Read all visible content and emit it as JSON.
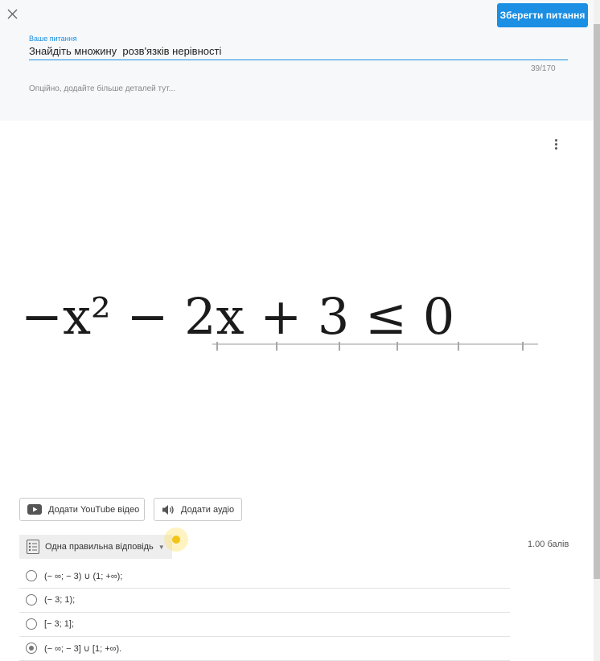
{
  "editor": {
    "save_button_label": "Зберегти питання",
    "question_field_label": "Ваше питання",
    "question_text": "Знайдіть множину  розв'язків нерівності",
    "char_counter": "39/170",
    "details_placeholder": "Опційно, додайте більше деталей тут..."
  },
  "media": {
    "math_image_text": "−x² − 2x + 3 ≤ 0",
    "youtube_button_label": "Додати YouTube відео",
    "audio_button_label": "Додати аудіо"
  },
  "answers_section": {
    "question_type_label": "Одна правильна відповідь",
    "points_label": "1.00 балів",
    "options": [
      {
        "text": "(− ∞; − 3) ∪ (1; +∞);",
        "selected": false
      },
      {
        "text": "(− 3; 1);",
        "selected": false
      },
      {
        "text": "[− 3; 1];",
        "selected": false
      },
      {
        "text": "(− ∞; − 3] ∪ [1; +∞).",
        "selected": true
      }
    ]
  },
  "icons": {
    "close": "close-icon",
    "more": "more-vertical-icon",
    "youtube": "youtube-icon",
    "audio": "speaker-icon",
    "list": "list-icon",
    "dropdown": "caret-down-icon"
  },
  "colors": {
    "accent": "#1a8fe3",
    "panel_background": "#f6f8fa",
    "cursor_highlight": "#f3c316"
  }
}
